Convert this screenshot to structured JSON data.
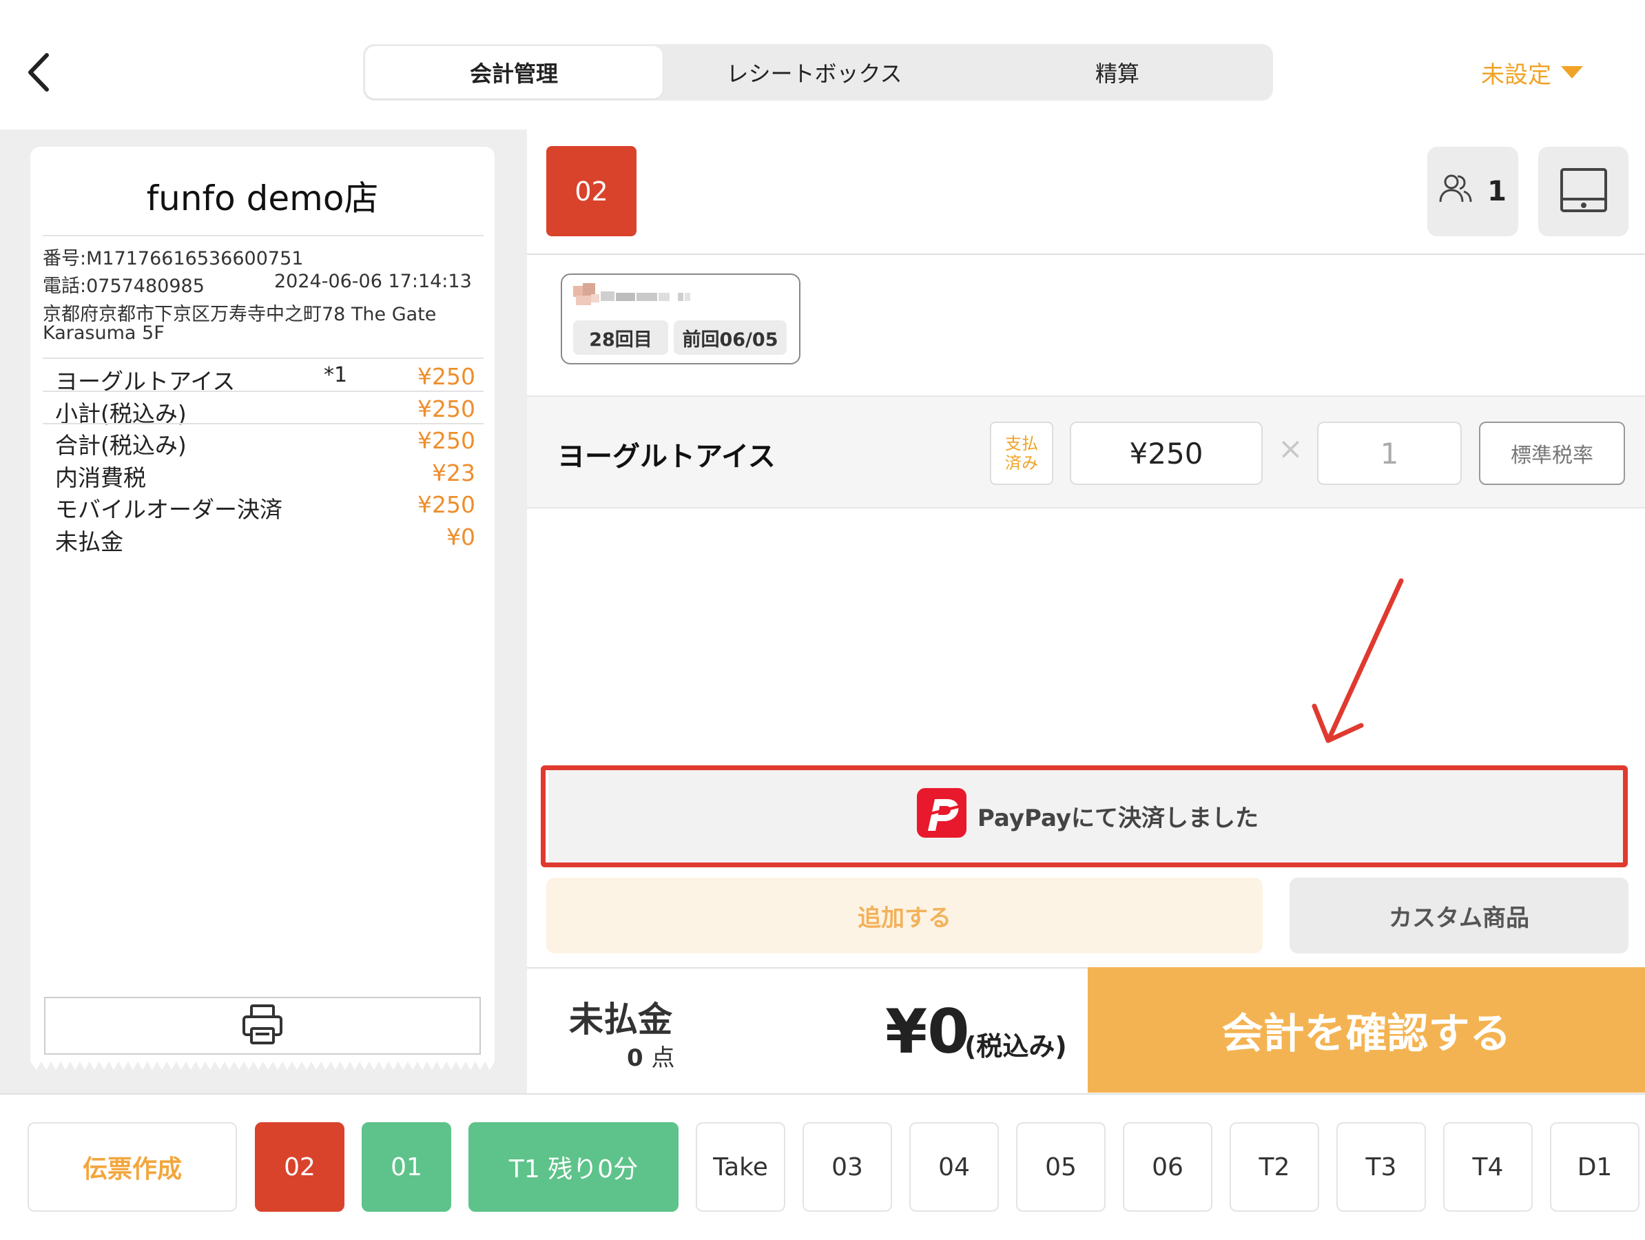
{
  "header": {
    "tabs": [
      {
        "label": "会計管理",
        "active": true
      },
      {
        "label": "レシートボックス",
        "active": false
      },
      {
        "label": "精算",
        "active": false
      }
    ],
    "unset_label": "未設定"
  },
  "receipt": {
    "store_name": "funfo demo店",
    "number": "番号:M17176616536600751",
    "phone": "電話:0757480985",
    "datetime": "2024-06-06 17:14:13",
    "address_line1": "京都府京都市下京区万寿寺中之町78 The Gate",
    "address_line2": "Karasuma 5F",
    "item": {
      "name": "ヨーグルトアイス",
      "qty": "*1",
      "price": "¥250"
    },
    "rows": [
      {
        "label": "小計(税込み)",
        "value": "¥250"
      },
      {
        "label": "合計(税込み)",
        "value": "¥250"
      },
      {
        "label": "内消費税",
        "value": "¥23"
      },
      {
        "label": "モバイルオーダー決済",
        "value": "¥250"
      },
      {
        "label": "未払金",
        "value": "¥0"
      }
    ]
  },
  "order": {
    "ticket_number": "02",
    "people_count": "1",
    "customer": {
      "visit_count": "28回目",
      "last_visit": "前回06/05"
    },
    "item": {
      "name": "ヨーグルトアイス",
      "paid_badge_line1": "支払",
      "paid_badge_line2": "済み",
      "price": "¥250",
      "times": "×",
      "qty": "1",
      "tax_button": "標準税率"
    },
    "paypay_text": "PayPayにて決済しました",
    "add_button": "追加する",
    "custom_button": "カスタム商品"
  },
  "summary": {
    "unpaid_label": "未払金",
    "count_value": "0",
    "count_unit": "点",
    "total": "¥0",
    "total_suffix": "(税込み)",
    "confirm_button": "会計を確認する"
  },
  "tables": [
    {
      "label": "伝票作成",
      "style": "orange"
    },
    {
      "label": "02",
      "style": "red"
    },
    {
      "label": "01",
      "style": "green"
    },
    {
      "label": "T1  残り0分",
      "style": "green"
    },
    {
      "label": "Take",
      "style": "plain"
    },
    {
      "label": "03",
      "style": "plain"
    },
    {
      "label": "04",
      "style": "plain"
    },
    {
      "label": "05",
      "style": "plain"
    },
    {
      "label": "06",
      "style": "plain"
    },
    {
      "label": "T2",
      "style": "plain"
    },
    {
      "label": "T3",
      "style": "plain"
    },
    {
      "label": "T4",
      "style": "plain"
    },
    {
      "label": "D1",
      "style": "plain"
    }
  ],
  "colors": {
    "accent_orange": "#f0a326",
    "ticket_red": "#d9432c",
    "table_green": "#5ec38a",
    "confirm_orange": "#f4b352",
    "highlight_red": "#e03a2f"
  }
}
